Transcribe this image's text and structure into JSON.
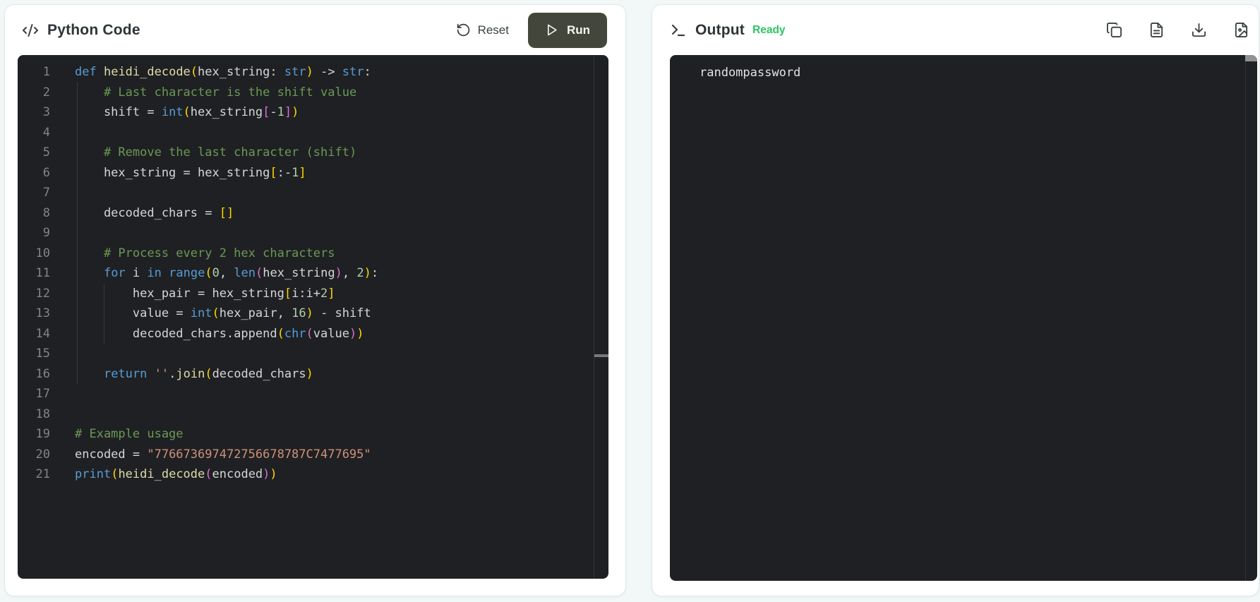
{
  "left_panel": {
    "title": "Python Code",
    "reset_label": "Reset",
    "run_label": "Run",
    "active_line": 16,
    "code_lines": [
      [
        [
          "k",
          "def"
        ],
        [
          "v",
          " "
        ],
        [
          "fn",
          "heidi_decode"
        ],
        [
          "b1",
          "("
        ],
        [
          "v",
          "hex_string: "
        ],
        [
          "k",
          "str"
        ],
        [
          "b1",
          ")"
        ],
        [
          "v",
          " -> "
        ],
        [
          "k",
          "str"
        ],
        [
          "v",
          ":"
        ]
      ],
      [
        [
          "v",
          "    "
        ],
        [
          "c",
          "# Last character is the shift value"
        ]
      ],
      [
        [
          "v",
          "    shift = "
        ],
        [
          "k",
          "int"
        ],
        [
          "b1",
          "("
        ],
        [
          "v",
          "hex_string"
        ],
        [
          "b2",
          "["
        ],
        [
          "v",
          "-"
        ],
        [
          "n",
          "1"
        ],
        [
          "b2",
          "]"
        ],
        [
          "b1",
          ")"
        ]
      ],
      [],
      [
        [
          "v",
          "    "
        ],
        [
          "c",
          "# Remove the last character (shift)"
        ]
      ],
      [
        [
          "v",
          "    hex_string = hex_string"
        ],
        [
          "b1",
          "["
        ],
        [
          "v",
          ":-"
        ],
        [
          "n",
          "1"
        ],
        [
          "b1",
          "]"
        ]
      ],
      [],
      [
        [
          "v",
          "    decoded_chars = "
        ],
        [
          "b1",
          "[]"
        ]
      ],
      [],
      [
        [
          "v",
          "    "
        ],
        [
          "c",
          "# Process every 2 hex characters"
        ]
      ],
      [
        [
          "v",
          "    "
        ],
        [
          "k",
          "for"
        ],
        [
          "v",
          " i "
        ],
        [
          "k",
          "in"
        ],
        [
          "v",
          " "
        ],
        [
          "k",
          "range"
        ],
        [
          "b1",
          "("
        ],
        [
          "n",
          "0"
        ],
        [
          "v",
          ", "
        ],
        [
          "k",
          "len"
        ],
        [
          "b2",
          "("
        ],
        [
          "v",
          "hex_string"
        ],
        [
          "b2",
          ")"
        ],
        [
          "v",
          ", "
        ],
        [
          "n",
          "2"
        ],
        [
          "b1",
          ")"
        ],
        [
          "v",
          ":"
        ]
      ],
      [
        [
          "v",
          "        hex_pair = hex_string"
        ],
        [
          "b1",
          "["
        ],
        [
          "v",
          "i:i+"
        ],
        [
          "n",
          "2"
        ],
        [
          "b1",
          "]"
        ]
      ],
      [
        [
          "v",
          "        value = "
        ],
        [
          "k",
          "int"
        ],
        [
          "b1",
          "("
        ],
        [
          "v",
          "hex_pair, "
        ],
        [
          "n",
          "16"
        ],
        [
          "b1",
          ")"
        ],
        [
          "v",
          " - shift"
        ]
      ],
      [
        [
          "v",
          "        decoded_chars.append"
        ],
        [
          "b1",
          "("
        ],
        [
          "k",
          "chr"
        ],
        [
          "b2",
          "("
        ],
        [
          "v",
          "value"
        ],
        [
          "b2",
          ")"
        ],
        [
          "b1",
          ")"
        ]
      ],
      [],
      [
        [
          "v",
          "    "
        ],
        [
          "k",
          "return"
        ],
        [
          "v",
          " "
        ],
        [
          "s",
          "''"
        ],
        [
          "v",
          "."
        ],
        [
          "fn",
          "join"
        ],
        [
          "b1",
          "("
        ],
        [
          "v",
          "decoded_chars"
        ],
        [
          "b1",
          ")"
        ]
      ],
      [],
      [],
      [
        [
          "c",
          "# Example usage"
        ]
      ],
      [
        [
          "v",
          "encoded = "
        ],
        [
          "s",
          "\"776673697472756678787C7477695\""
        ]
      ],
      [
        [
          "k",
          "print"
        ],
        [
          "b1",
          "("
        ],
        [
          "fn",
          "heidi_decode"
        ],
        [
          "b2",
          "("
        ],
        [
          "v",
          "encoded"
        ],
        [
          "b2",
          ")"
        ],
        [
          "b1",
          ")"
        ]
      ]
    ]
  },
  "right_panel": {
    "title": "Output",
    "status": "Ready",
    "output_text": "randompassword",
    "toolbar_icons": [
      "copy",
      "file-text",
      "download",
      "file-image"
    ]
  },
  "colors": {
    "status_ready": "#2ec464",
    "run_button_bg": "#43463a",
    "terminal_bg": "#1f2023"
  }
}
